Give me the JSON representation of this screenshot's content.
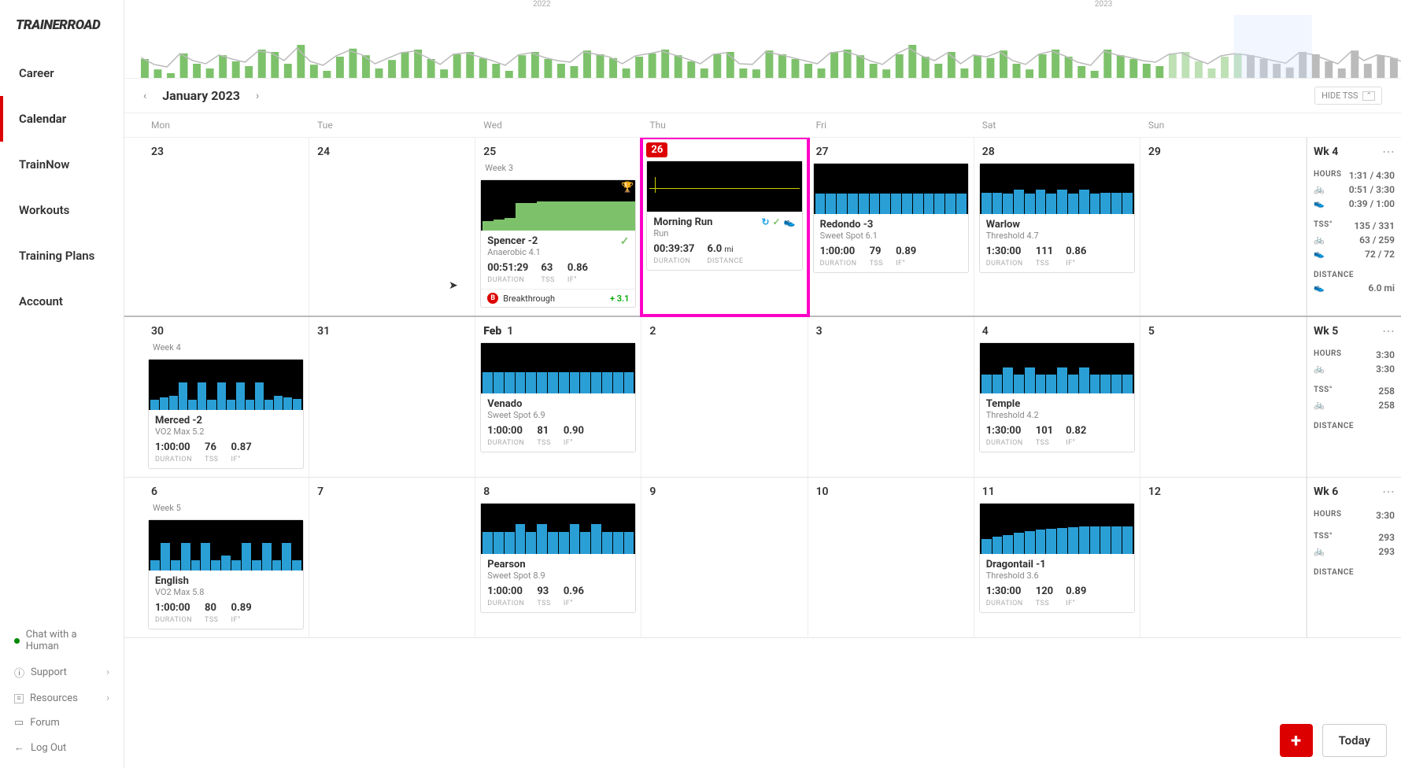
{
  "logo": "TRAINERROAD",
  "nav": {
    "items": [
      "Career",
      "Calendar",
      "TrainNow",
      "Workouts",
      "Training Plans",
      "Account"
    ],
    "active": 1
  },
  "footer": {
    "chat": "Chat with a Human",
    "support": "Support",
    "resources": "Resources",
    "forum": "Forum",
    "logout": "Log Out"
  },
  "years": {
    "a": "2022",
    "b": "2023"
  },
  "month_label": "January 2023",
  "hide_tss": "HIDE TSS",
  "day_headers": [
    "Mon",
    "Tue",
    "Wed",
    "Thu",
    "Fri",
    "Sat",
    "Sun"
  ],
  "labels": {
    "duration": "DURATION",
    "tss": "TSS",
    "if": "IF°",
    "distance": "DISTANCE"
  },
  "weeks": [
    {
      "wk": "Wk 4",
      "current": true,
      "days": [
        {
          "num": "23"
        },
        {
          "num": "24"
        },
        {
          "num": "25",
          "weeklabel": "Week 3",
          "card": {
            "title": "Spencer -2",
            "sub": "Anaerobic 4.1",
            "dur": "00:51:29",
            "tss": "63",
            "if": "0.86",
            "trophy": true,
            "done": true,
            "bars": "overlay",
            "breakthrough": {
              "label": "Breakthrough",
              "gain": "+ 3.1"
            }
          }
        },
        {
          "num": "26",
          "today": true,
          "card": {
            "title": "Morning Run",
            "sub": "Run",
            "dur": "00:39:37",
            "dist": "6.0",
            "unit": "mi",
            "icons": true,
            "bars": "run"
          }
        },
        {
          "num": "27",
          "card": {
            "title": "Redondo -3",
            "sub": "Sweet Spot 6.1",
            "dur": "1:00:00",
            "tss": "79",
            "if": "0.89",
            "bars": "ss"
          }
        },
        {
          "num": "28",
          "card": {
            "title": "Warlow",
            "sub": "Threshold 4.7",
            "dur": "1:30:00",
            "tss": "111",
            "if": "0.86",
            "bars": "thr"
          }
        },
        {
          "num": "29"
        }
      ],
      "summary": {
        "hours": "1:31 / 4:30",
        "bike": "0:51 / 3:30",
        "run": "0:39 / 1:00",
        "tss": "135 / 331",
        "tss_bike": "63 / 259",
        "tss_run": "72 / 72",
        "dist": "",
        "dist_run": "6.0 mi"
      }
    },
    {
      "wk": "Wk 5",
      "days": [
        {
          "num": "30",
          "weeklabel": "Week 4",
          "card": {
            "title": "Merced -2",
            "sub": "VO2 Max 5.2",
            "dur": "1:00:00",
            "tss": "76",
            "if": "0.87",
            "bars": "vo2"
          }
        },
        {
          "num": "31"
        },
        {
          "num": "1",
          "newmonth": "Feb",
          "card": {
            "title": "Venado",
            "sub": "Sweet Spot 6.9",
            "dur": "1:00:00",
            "tss": "81",
            "if": "0.90",
            "bars": "ss2"
          }
        },
        {
          "num": "2"
        },
        {
          "num": "3"
        },
        {
          "num": "4",
          "card": {
            "title": "Temple",
            "sub": "Threshold 4.2",
            "dur": "1:30:00",
            "tss": "101",
            "if": "0.82",
            "bars": "thr2"
          }
        },
        {
          "num": "5"
        }
      ],
      "summary": {
        "hours": "3:30",
        "bike": "3:30",
        "tss": "258",
        "tss_bike": "258",
        "dist": ""
      }
    },
    {
      "wk": "Wk 6",
      "days": [
        {
          "num": "6",
          "weeklabel": "Week 5",
          "card": {
            "title": "English",
            "sub": "VO2 Max 5.8",
            "dur": "1:00:00",
            "tss": "80",
            "if": "0.89",
            "bars": "vo2b"
          }
        },
        {
          "num": "7"
        },
        {
          "num": "8",
          "card": {
            "title": "Pearson",
            "sub": "Sweet Spot 8.9",
            "dur": "1:00:00",
            "tss": "93",
            "if": "0.96",
            "bars": "ss3"
          }
        },
        {
          "num": "9"
        },
        {
          "num": "10"
        },
        {
          "num": "11",
          "card": {
            "title": "Dragontail -1",
            "sub": "Threshold 3.6",
            "dur": "1:30:00",
            "tss": "120",
            "if": "0.89",
            "bars": "thr3"
          }
        },
        {
          "num": "12"
        }
      ],
      "summary": {
        "hours": "3:30",
        "bike": "",
        "tss": "293",
        "tss_bike": "293",
        "dist": ""
      }
    }
  ],
  "summary_labels": {
    "hours": "HOURS",
    "tss": "TSS°",
    "distance": "DISTANCE"
  },
  "today_btn": "Today",
  "chart_data": {
    "type": "bar",
    "note": "TSS-by-week overview strip; heights are visual estimates 0-100",
    "series": [
      {
        "name": "TSS",
        "values": [
          40,
          18,
          10,
          52,
          30,
          20,
          48,
          35,
          25,
          60,
          55,
          30,
          70,
          28,
          15,
          45,
          62,
          48,
          20,
          38,
          55,
          60,
          40,
          18,
          50,
          55,
          42,
          30,
          15,
          48,
          55,
          40,
          30,
          25,
          58,
          50,
          42,
          20,
          45,
          52,
          60,
          48,
          35,
          20,
          50,
          55,
          20,
          18,
          58,
          50,
          40,
          30,
          20,
          55,
          60,
          48,
          30,
          18,
          50,
          70,
          45,
          30,
          55,
          20,
          48,
          42,
          58,
          30,
          18,
          50,
          60,
          45,
          25,
          15,
          60,
          48,
          40,
          30,
          25,
          50,
          55,
          35,
          20,
          45,
          52,
          48,
          40,
          30,
          22,
          55,
          50,
          35,
          20,
          58,
          30,
          48,
          42,
          25
        ]
      }
    ]
  }
}
